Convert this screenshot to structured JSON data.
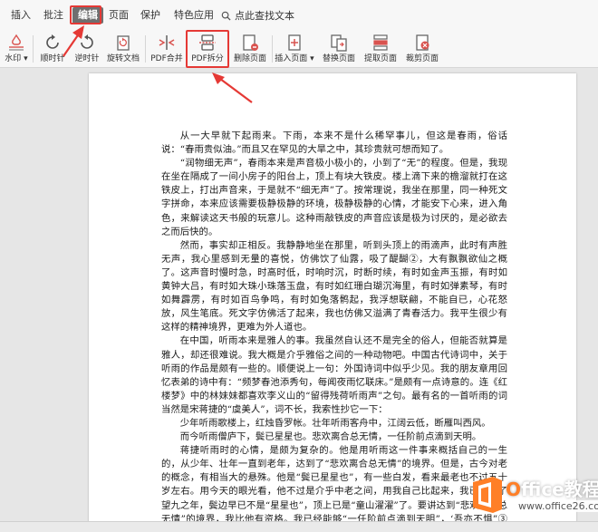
{
  "menu": {
    "items": [
      {
        "label": "插入"
      },
      {
        "label": "批注"
      },
      {
        "label": "编辑",
        "active": true
      },
      {
        "label": "页面"
      },
      {
        "label": "保护"
      },
      {
        "label": "特色应用"
      }
    ],
    "search_label": "点此查找文本"
  },
  "ribbon": {
    "tools": [
      {
        "label": "水印",
        "icon": "watermark-icon"
      },
      {
        "label": "顺时针",
        "icon": "rotate-clockwise-icon"
      },
      {
        "label": "逆时针",
        "icon": "rotate-counterclockwise-icon"
      },
      {
        "label": "旋转文档",
        "icon": "rotate-document-icon"
      },
      {
        "label": "PDF合并",
        "icon": "pdf-merge-icon"
      },
      {
        "label": "PDF拆分",
        "icon": "pdf-split-icon"
      },
      {
        "label": "删除页面",
        "icon": "delete-page-icon"
      },
      {
        "label": "插入页面",
        "icon": "insert-page-icon"
      },
      {
        "label": "替换页面",
        "icon": "replace-page-icon"
      },
      {
        "label": "提取页面",
        "icon": "extract-page-icon"
      },
      {
        "label": "裁剪页面",
        "icon": "crop-page-icon"
      }
    ]
  },
  "document": {
    "paragraphs": [
      "从一大早就下起雨来。下雨，本来不是什么稀罕事儿，但这是春雨，俗话说：“春雨贵似油。”而且又在罕见的大旱之中，其珍贵就可想而知了。",
      "“润物细无声”，春雨本来是声音极小极小的，小到了“无”的程度。但是，我现在坐在隔成了一间小房子的阳台上，顶上有块大铁皮。楼上滴下来的檐溜就打在这铁皮上，打出声音来，于是就不“细无声”了。按常理说，我坐在那里，同一种死文字拼命，本来应该需要极静极静的环境，极静极静的心情，才能安下心来，进入角色，来解读这天书般的玩意儿。这种雨敲铁皮的声音应该是极为讨厌的，是必欲去之而后快的。",
      "然而，事实却正相反。我静静地坐在那里，听到头顶上的雨滴声，此时有声胜无声，我心里感到无量的喜悦，仿佛饮了仙露，吸了醍醐②，大有飘飘欲仙之概了。这声音时慢时急，时高时低，时响时沉，时断时续，有时如金声玉振，有时如黄钟大吕，有时如大珠小珠落玉盘，有时如红珊白瑚沉海里，有时如弹素琴，有时如舞霹雳，有时如百鸟争鸣，有时如兔落鹘起，我浮想联翩，不能自已，心花怒放，风生笔底。死文字仿佛活了起来，我也仿佛又溢满了青春活力。我平生很少有这样的精神境界，更难为外人道也。",
      "在中国，听雨本来是雅人的事。我虽然自认还不是完全的俗人，但能否就算是雅人，却还很难说。我大概是介乎雅俗之间的一种动物吧。中国古代诗词中，关于听雨的作品是颇有一些的。顺便说上一句：外国诗词中似乎少见。我的朋友章用回忆表弟的诗中有：“频梦春池添秀句，每闻夜雨忆联床。”是颇有一点诗意的。连《红楼梦》中的林妹妹都喜欢李义山的“留得残荷听雨声”之句。最有名的一首听雨的词当然是宋蒋捷的“虞美人”，词不长，我索性抄它一下：",
      "少年听雨歌楼上，红烛昏罗帐。壮年听雨客舟中，江阔云低，断雁叫西风。",
      "而今听雨僧庐下，鬓已星星也。悲欢离合总无情，一任阶前点滴到天明。",
      "蒋捷听雨时的心情，是颇为复杂的。他是用听雨这一件事来概括自己的一生的，从少年、壮年一直到老年，达到了“悲欢离合总无情”的境界。但是，古今对老的概念，有相当大的悬殊。他是“鬓已星星也”，有一些白发，看来最老也不过五十岁左右。用今天的眼光看，他不过是介乎中老之间，用我自己比起来，我已经到了望九之年，鬓边早已不是“星星也”，顶上已是“童山濯濯”了。要讲达到“悲欢离合总无情”的境界，我比他有资格。我已经能够“一任阶前点滴到天明”，‘吾亦不惧”③了。"
    ]
  },
  "watermark": {
    "title_prefix": "O",
    "title_rest": "ffice教程网",
    "url": "www.office26.com"
  }
}
